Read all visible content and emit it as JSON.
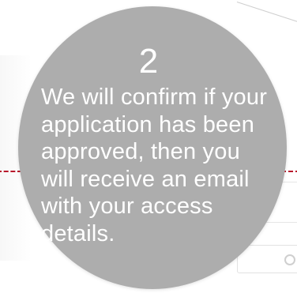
{
  "step": {
    "number": "2",
    "text": "We will confirm if your\napplication has been\napproved, then you\nwill receive an email\nwith your access\ndetails."
  },
  "colors": {
    "circle_fill": "#adadad",
    "dashed_line": "#b8182b",
    "text": "#ffffff"
  }
}
